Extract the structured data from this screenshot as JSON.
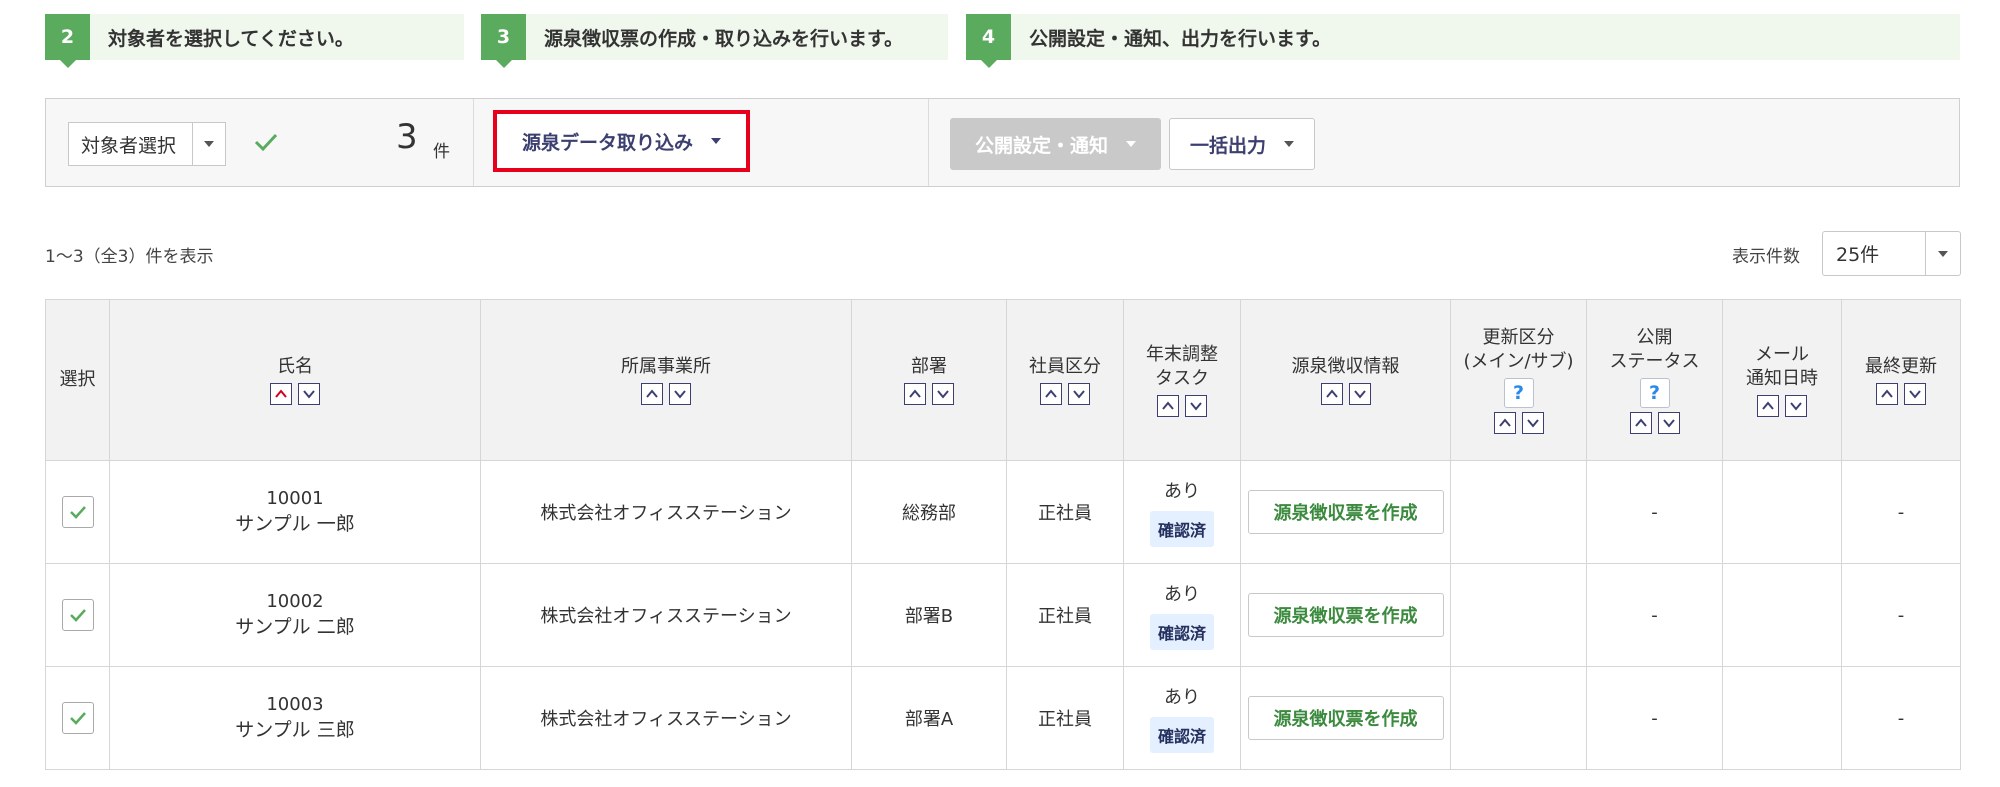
{
  "steps": [
    {
      "num": "2",
      "text": "対象者を選択してください。"
    },
    {
      "num": "3",
      "text": "源泉徴収票の作成・取り込みを行います。"
    },
    {
      "num": "4",
      "text": "公開設定・通知、出力を行います。"
    }
  ],
  "toolbar": {
    "target_select_label": "対象者選択",
    "count": "3",
    "count_unit": "件",
    "import_button": "源泉データ取り込み",
    "publish_button": "公開設定・通知",
    "export_button": "一括出力"
  },
  "list_info": {
    "range_text": "1〜3（全3）件を表示",
    "per_page_label": "表示件数",
    "per_page_value": "25件"
  },
  "table": {
    "headers": {
      "select": "選択",
      "name": "氏名",
      "office": "所属事業所",
      "dept": "部署",
      "emp_type": "社員区分",
      "yearend_line1": "年末調整",
      "yearend_line2": "タスク",
      "withholding": "源泉徴収情報",
      "update_line1": "更新区分",
      "update_line2": "(メイン/サブ)",
      "public_line1": "公開",
      "public_line2": "ステータス",
      "mail_line1": "メール",
      "mail_line2": "通知日時",
      "last_update": "最終更新"
    },
    "help_mark": "?",
    "rows": [
      {
        "id": "10001",
        "name": "サンプル 一郎",
        "office": "株式会社オフィスステーション",
        "dept": "総務部",
        "emp_type": "正社員",
        "task": "あり",
        "task_badge": "確認済",
        "action": "源泉徴収票を作成",
        "update_type": "",
        "public_status": "-",
        "mail_date": "",
        "last_update": "-"
      },
      {
        "id": "10002",
        "name": "サンプル 二郎",
        "office": "株式会社オフィスステーション",
        "dept": "部署B",
        "emp_type": "正社員",
        "task": "あり",
        "task_badge": "確認済",
        "action": "源泉徴収票を作成",
        "update_type": "",
        "public_status": "-",
        "mail_date": "",
        "last_update": "-"
      },
      {
        "id": "10003",
        "name": "サンプル 三郎",
        "office": "株式会社オフィスステーション",
        "dept": "部署A",
        "emp_type": "正社員",
        "task": "あり",
        "task_badge": "確認済",
        "action": "源泉徴収票を作成",
        "update_type": "",
        "public_status": "-",
        "mail_date": "",
        "last_update": "-"
      }
    ]
  },
  "colors": {
    "step_green": "#5aab5e",
    "highlight_red": "#e6001c",
    "navy_text": "#3c3f70",
    "create_green": "#3b8a3e",
    "badge_bg": "#e4efff"
  }
}
